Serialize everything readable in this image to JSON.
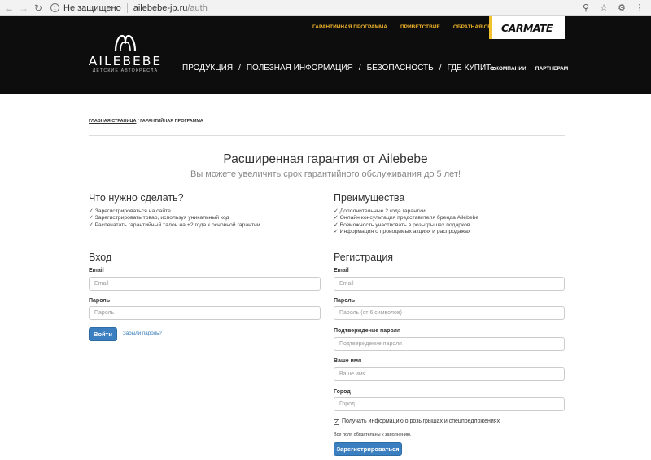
{
  "browser": {
    "security_text": "Не защищено",
    "url_host": "ailebebe-jp.ru",
    "url_path": "/auth"
  },
  "header": {
    "top_links": [
      "ГАРАНТИЙНАЯ ПРОГРАММА",
      "ПРИВЕТСТВИЕ",
      "ОБРАТНАЯ СВЯЗЬ"
    ],
    "partner_logo": "CARMATE",
    "logo_text": "AILEBEBE",
    "logo_sub": "ДЕТСКИЕ АВТОКРЕСЛА",
    "main_nav": [
      "ПРОДУКЦИЯ",
      "ПОЛЕЗНАЯ ИНФОРМАЦИЯ",
      "БЕЗОПАСНОСТЬ",
      "ГДЕ КУПИТЬ"
    ],
    "nav_separator": "/",
    "sub_nav": [
      "О КОМПАНИИ",
      "ПАРТНЕРАМ"
    ]
  },
  "breadcrumb": {
    "home": "ГЛАВНАЯ СТРАНИЦА",
    "separator": " / ",
    "current": "ГАРАНТИЙНАЯ ПРОГРАММА"
  },
  "page": {
    "title": "Расширенная гарантия от Ailebebe",
    "subtitle": "Вы можете увеличить срок гарантийного обслуживания до 5 лет!"
  },
  "todo": {
    "heading": "Что нужно сделать?",
    "items": [
      "✓ Зарегистрироваться на сайте",
      "✓ Зарегистрировать товар, используя уникальный код",
      "✓ Распечатать гарантийный талон на +2 года к основной гарантии"
    ]
  },
  "benefits": {
    "heading": "Преимущества",
    "items": [
      "✓ Дополнительные 2 года гарантии",
      "✓ Онлайн консультация представителя бренда Ailebebe",
      "✓ Возможность участвовать в розыгрышах подарков",
      "✓ Информация о проводимых акциях и распродажах"
    ]
  },
  "login": {
    "heading": "Вход",
    "email_label": "Email",
    "email_placeholder": "Email",
    "password_label": "Пароль",
    "password_placeholder": "Пароль",
    "submit": "Войти",
    "forgot": "Забыли пароль?"
  },
  "register": {
    "heading": "Регистрация",
    "email_label": "Email",
    "email_placeholder": "Email",
    "password_label": "Пароль",
    "password_placeholder": "Пароль (от 6 символов)",
    "confirm_label": "Подтверждение пароля",
    "confirm_placeholder": "Подтверждение пароля",
    "name_label": "Ваше имя",
    "name_placeholder": "Ваше имя",
    "city_label": "Город",
    "city_placeholder": "Город",
    "subscribe_checked": true,
    "subscribe_text": "Получать информацию о розыгрышах и спецпредложениях",
    "required_note": "Все поля обязательны к заполнению.",
    "submit": "Зарегистрироваться"
  },
  "colors": {
    "header_bg": "#0d0d0d",
    "accent_yellow": "#f0b428",
    "button_blue": "#3c7fc0"
  }
}
